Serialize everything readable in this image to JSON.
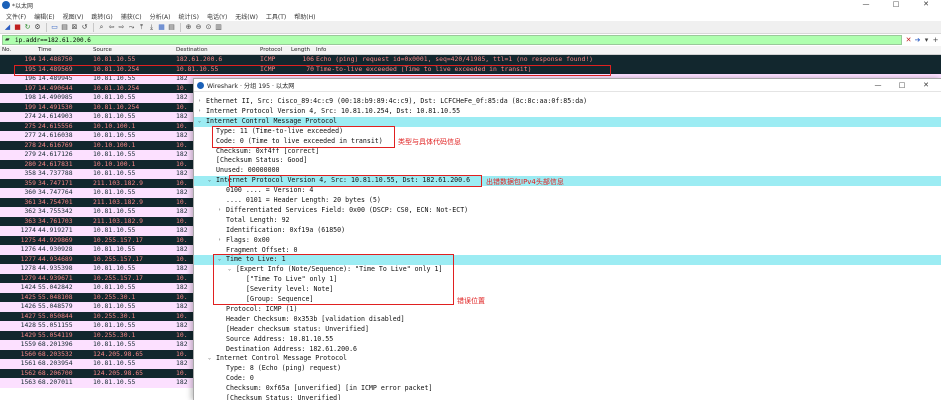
{
  "window": {
    "title": "*以太网",
    "controls": [
      "—",
      "□",
      "✕"
    ]
  },
  "menu": [
    "文件(F)",
    "编辑(E)",
    "视图(V)",
    "跳转(G)",
    "捕获(C)",
    "分析(A)",
    "统计(S)",
    "电话(Y)",
    "无线(W)",
    "工具(T)",
    "帮助(H)"
  ],
  "toolbar_icons": [
    {
      "name": "shark-fin-start-icon",
      "glyph": "◢",
      "tone": "blue"
    },
    {
      "name": "stop-capture-icon",
      "glyph": "■",
      "tone": "red"
    },
    {
      "name": "restart-capture-icon",
      "glyph": "↻",
      "tone": "green"
    },
    {
      "name": "capture-options-icon",
      "glyph": "⚙",
      "tone": ""
    },
    {
      "name": "sep"
    },
    {
      "name": "open-file-icon",
      "glyph": "▭",
      "tone": "blue"
    },
    {
      "name": "save-file-icon",
      "glyph": "▤",
      "tone": ""
    },
    {
      "name": "close-file-icon",
      "glyph": "⊠",
      "tone": ""
    },
    {
      "name": "reload-file-icon",
      "glyph": "↺",
      "tone": ""
    },
    {
      "name": "sep"
    },
    {
      "name": "find-packet-icon",
      "glyph": "⌕",
      "tone": ""
    },
    {
      "name": "go-back-icon",
      "glyph": "⇦",
      "tone": ""
    },
    {
      "name": "go-forward-icon",
      "glyph": "⇨",
      "tone": ""
    },
    {
      "name": "go-to-packet-icon",
      "glyph": "⤳",
      "tone": ""
    },
    {
      "name": "first-packet-icon",
      "glyph": "⤒",
      "tone": ""
    },
    {
      "name": "last-packet-icon",
      "glyph": "⤓",
      "tone": ""
    },
    {
      "name": "autoscroll-icon",
      "glyph": "▦",
      "tone": "blue"
    },
    {
      "name": "colorize-icon",
      "glyph": "▤",
      "tone": ""
    },
    {
      "name": "sep"
    },
    {
      "name": "zoom-in-icon",
      "glyph": "⊕",
      "tone": ""
    },
    {
      "name": "zoom-out-icon",
      "glyph": "⊖",
      "tone": ""
    },
    {
      "name": "zoom-reset-icon",
      "glyph": "⊙",
      "tone": ""
    },
    {
      "name": "resize-columns-icon",
      "glyph": "▥",
      "tone": ""
    }
  ],
  "filter": {
    "icon": "bookmark-icon",
    "value": "ip.addr==182.61.200.6",
    "buttons": [
      {
        "name": "clear-filter-button",
        "glyph": "✕",
        "cls": "clear"
      },
      {
        "name": "apply-filter-button",
        "glyph": "➔",
        "cls": "apply"
      },
      {
        "name": "filter-dropdown-button",
        "glyph": "▾",
        "cls": ""
      },
      {
        "name": "add-filter-button",
        "glyph": "+",
        "cls": ""
      }
    ]
  },
  "packet_list": {
    "columns": [
      "No.",
      "Time",
      "Source",
      "Destination",
      "Protocol",
      "Length",
      "Info"
    ],
    "rows": [
      {
        "style": "sel",
        "no": "194",
        "time": "14.488750",
        "src": "10.81.10.55",
        "dst": "182.61.200.6",
        "proto": "ICMP",
        "len": "106",
        "info": "Echo (ping) request  id=0x0001, seq=420/41985, ttl=1 (no response found!)"
      },
      {
        "style": "dark",
        "no": "195",
        "time": "14.489569",
        "src": "10.81.10.254",
        "dst": "10.81.10.55",
        "proto": "ICMP",
        "len": "70",
        "info": "Time-to-live exceeded (Time to live exceeded in transit)"
      },
      {
        "style": "pink",
        "no": "196",
        "time": "14.489945",
        "src": "10.81.10.55",
        "dst": "182",
        "proto": "",
        "len": "",
        "info": ""
      },
      {
        "style": "dark",
        "no": "197",
        "time": "14.490644",
        "src": "10.81.10.254",
        "dst": "10.",
        "proto": "",
        "len": "",
        "info": ""
      },
      {
        "style": "pink",
        "no": "198",
        "time": "14.490985",
        "src": "10.81.10.55",
        "dst": "182",
        "proto": "",
        "len": "",
        "info": ""
      },
      {
        "style": "dark",
        "no": "199",
        "time": "14.491530",
        "src": "10.81.10.254",
        "dst": "10.",
        "proto": "",
        "len": "",
        "info": ""
      },
      {
        "style": "pink",
        "no": "274",
        "time": "24.614903",
        "src": "10.81.10.55",
        "dst": "182",
        "proto": "",
        "len": "",
        "info": ""
      },
      {
        "style": "dark",
        "no": "275",
        "time": "24.615556",
        "src": "10.10.100.1",
        "dst": "10.",
        "proto": "",
        "len": "",
        "info": ""
      },
      {
        "style": "pink",
        "no": "277",
        "time": "24.616038",
        "src": "10.81.10.55",
        "dst": "182",
        "proto": "",
        "len": "",
        "info": ""
      },
      {
        "style": "dark",
        "no": "278",
        "time": "24.616769",
        "src": "10.10.100.1",
        "dst": "10.",
        "proto": "",
        "len": "",
        "info": ""
      },
      {
        "style": "pink",
        "no": "279",
        "time": "24.617126",
        "src": "10.81.10.55",
        "dst": "182",
        "proto": "",
        "len": "",
        "info": ""
      },
      {
        "style": "dark",
        "no": "280",
        "time": "24.617831",
        "src": "10.10.100.1",
        "dst": "10.",
        "proto": "",
        "len": "",
        "info": ""
      },
      {
        "style": "pink",
        "no": "358",
        "time": "34.737788",
        "src": "10.81.10.55",
        "dst": "182",
        "proto": "",
        "len": "",
        "info": ""
      },
      {
        "style": "dark",
        "no": "359",
        "time": "34.747171",
        "src": "211.103.182.9",
        "dst": "10.",
        "proto": "",
        "len": "",
        "info": ""
      },
      {
        "style": "pink",
        "no": "360",
        "time": "34.747764",
        "src": "10.81.10.55",
        "dst": "182",
        "proto": "",
        "len": "",
        "info": ""
      },
      {
        "style": "dark",
        "no": "361",
        "time": "34.754701",
        "src": "211.103.182.9",
        "dst": "10.",
        "proto": "",
        "len": "",
        "info": ""
      },
      {
        "style": "pink",
        "no": "362",
        "time": "34.755342",
        "src": "10.81.10.55",
        "dst": "182",
        "proto": "",
        "len": "",
        "info": ""
      },
      {
        "style": "dark",
        "no": "363",
        "time": "34.761703",
        "src": "211.103.182.9",
        "dst": "10.",
        "proto": "",
        "len": "",
        "info": ""
      },
      {
        "style": "pink",
        "no": "1274",
        "time": "44.919271",
        "src": "10.81.10.55",
        "dst": "182",
        "proto": "",
        "len": "",
        "info": ""
      },
      {
        "style": "dark",
        "no": "1275",
        "time": "44.929869",
        "src": "10.255.157.17",
        "dst": "10.",
        "proto": "",
        "len": "",
        "info": ""
      },
      {
        "style": "pink",
        "no": "1276",
        "time": "44.930928",
        "src": "10.81.10.55",
        "dst": "182",
        "proto": "",
        "len": "",
        "info": ""
      },
      {
        "style": "dark",
        "no": "1277",
        "time": "44.934689",
        "src": "10.255.157.17",
        "dst": "10.",
        "proto": "",
        "len": "",
        "info": ""
      },
      {
        "style": "pink",
        "no": "1278",
        "time": "44.935398",
        "src": "10.81.10.55",
        "dst": "182",
        "proto": "",
        "len": "",
        "info": ""
      },
      {
        "style": "dark",
        "no": "1279",
        "time": "44.939671",
        "src": "10.255.157.17",
        "dst": "10.",
        "proto": "",
        "len": "",
        "info": ""
      },
      {
        "style": "pink",
        "no": "1424",
        "time": "55.042842",
        "src": "10.81.10.55",
        "dst": "182",
        "proto": "",
        "len": "",
        "info": ""
      },
      {
        "style": "dark",
        "no": "1425",
        "time": "55.048108",
        "src": "10.255.30.1",
        "dst": "10.",
        "proto": "",
        "len": "",
        "info": ""
      },
      {
        "style": "pink",
        "no": "1426",
        "time": "55.048579",
        "src": "10.81.10.55",
        "dst": "182",
        "proto": "",
        "len": "",
        "info": ""
      },
      {
        "style": "dark",
        "no": "1427",
        "time": "55.050844",
        "src": "10.255.30.1",
        "dst": "10.",
        "proto": "",
        "len": "",
        "info": ""
      },
      {
        "style": "pink",
        "no": "1428",
        "time": "55.051155",
        "src": "10.81.10.55",
        "dst": "182",
        "proto": "",
        "len": "",
        "info": ""
      },
      {
        "style": "dark",
        "no": "1429",
        "time": "55.054119",
        "src": "10.255.30.1",
        "dst": "10.",
        "proto": "",
        "len": "",
        "info": ""
      },
      {
        "style": "pink",
        "no": "1559",
        "time": "68.201396",
        "src": "10.81.10.55",
        "dst": "182",
        "proto": "",
        "len": "",
        "info": ""
      },
      {
        "style": "dark",
        "no": "1560",
        "time": "68.203532",
        "src": "124.205.98.65",
        "dst": "10.",
        "proto": "",
        "len": "",
        "info": ""
      },
      {
        "style": "pink",
        "no": "1561",
        "time": "68.203954",
        "src": "10.81.10.55",
        "dst": "182",
        "proto": "",
        "len": "",
        "info": ""
      },
      {
        "style": "dark",
        "no": "1562",
        "time": "68.206700",
        "src": "124.205.98.65",
        "dst": "10.",
        "proto": "",
        "len": "",
        "info": ""
      },
      {
        "style": "pink",
        "no": "1563",
        "time": "68.207011",
        "src": "10.81.10.55",
        "dst": "182",
        "proto": "",
        "len": "",
        "info": ""
      }
    ]
  },
  "detail_window": {
    "title": "Wireshark · 分组 195 · 以太网",
    "controls": [
      "—",
      "□",
      "✕"
    ],
    "rows": [
      {
        "indent": 0,
        "arrow": "›",
        "hl": false,
        "text": "Ethernet II, Src: Cisco_89:4c:c9 (00:18:b9:89:4c:c9), Dst: LCFCHeFe_0f:85:da (8c:8c:aa:0f:85:da)"
      },
      {
        "indent": 0,
        "arrow": "›",
        "hl": false,
        "text": "Internet Protocol Version 4, Src: 10.81.10.254, Dst: 10.81.10.55"
      },
      {
        "indent": 0,
        "arrow": "⌄",
        "hl": true,
        "text": "Internet Control Message Protocol"
      },
      {
        "indent": 1,
        "arrow": "",
        "hl": false,
        "text": "Type: 11 (Time-to-live exceeded)"
      },
      {
        "indent": 1,
        "arrow": "",
        "hl": false,
        "text": "Code: 0 (Time to live exceeded in transit)"
      },
      {
        "indent": 1,
        "arrow": "",
        "hl": false,
        "text": "Checksum: 0xf4ff [correct]"
      },
      {
        "indent": 1,
        "arrow": "",
        "hl": false,
        "text": "[Checksum Status: Good]"
      },
      {
        "indent": 1,
        "arrow": "",
        "hl": false,
        "text": "Unused: 00000000"
      },
      {
        "indent": 1,
        "arrow": "⌄",
        "hl": true,
        "text": "Internet Protocol Version 4, Src: 10.81.10.55, Dst: 182.61.200.6"
      },
      {
        "indent": 2,
        "arrow": "",
        "hl": false,
        "text": "0100 .... = Version: 4"
      },
      {
        "indent": 2,
        "arrow": "",
        "hl": false,
        "text": ".... 0101 = Header Length: 20 bytes (5)"
      },
      {
        "indent": 2,
        "arrow": "›",
        "hl": false,
        "text": "Differentiated Services Field: 0x00 (DSCP: CS0, ECN: Not-ECT)"
      },
      {
        "indent": 2,
        "arrow": "",
        "hl": false,
        "text": "Total Length: 92"
      },
      {
        "indent": 2,
        "arrow": "",
        "hl": false,
        "text": "Identification: 0xf19a (61850)"
      },
      {
        "indent": 2,
        "arrow": "›",
        "hl": false,
        "text": "Flags: 0x00"
      },
      {
        "indent": 2,
        "arrow": "",
        "hl": false,
        "text": "Fragment Offset: 0"
      },
      {
        "indent": 2,
        "arrow": "⌄",
        "hl": true,
        "text": "Time to Live: 1"
      },
      {
        "indent": 3,
        "arrow": "⌄",
        "hl": false,
        "text": "[Expert Info (Note/Sequence): \"Time To Live\" only 1]"
      },
      {
        "indent": 4,
        "arrow": "",
        "hl": false,
        "text": "[\"Time To Live\" only 1]"
      },
      {
        "indent": 4,
        "arrow": "",
        "hl": false,
        "text": "[Severity level: Note]"
      },
      {
        "indent": 4,
        "arrow": "",
        "hl": false,
        "text": "[Group: Sequence]"
      },
      {
        "indent": 2,
        "arrow": "",
        "hl": false,
        "text": "Protocol: ICMP (1)"
      },
      {
        "indent": 2,
        "arrow": "",
        "hl": false,
        "text": "Header Checksum: 0x353b [validation disabled]"
      },
      {
        "indent": 2,
        "arrow": "",
        "hl": false,
        "text": "[Header checksum status: Unverified]"
      },
      {
        "indent": 2,
        "arrow": "",
        "hl": false,
        "text": "Source Address: 10.81.10.55"
      },
      {
        "indent": 2,
        "arrow": "",
        "hl": false,
        "text": "Destination Address: 182.61.200.6"
      },
      {
        "indent": 1,
        "arrow": "⌄",
        "hl": false,
        "text": "Internet Control Message Protocol"
      },
      {
        "indent": 2,
        "arrow": "",
        "hl": false,
        "text": "Type: 8 (Echo (ping) request)"
      },
      {
        "indent": 2,
        "arrow": "",
        "hl": false,
        "text": "Code: 0"
      },
      {
        "indent": 2,
        "arrow": "",
        "hl": false,
        "text": "Checksum: 0xf65a [unverified] [in ICMP error packet]"
      },
      {
        "indent": 2,
        "arrow": "",
        "hl": false,
        "text": "[Checksum Status: Unverified]"
      }
    ]
  },
  "annotations": {
    "type_code": "类型与具体代码信息",
    "ipv4_header": "出错数据包IPv4头部信息",
    "error_location": "错误位置"
  },
  "colors": {
    "annotation_red": "#e02020",
    "row_pink": "#fce0ff",
    "row_dark": "#12272e",
    "row_dark_text": "#f78787",
    "tree_highlight": "#9cecf3",
    "filter_green": "#afffaf"
  }
}
